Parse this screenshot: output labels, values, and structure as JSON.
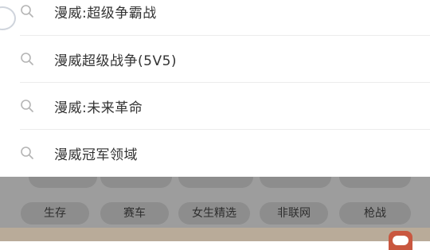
{
  "suggestions": [
    {
      "label": "漫威:超级争霸战",
      "icon": "search-icon"
    },
    {
      "label": "漫威超级战争(5V5)",
      "icon": "search-icon"
    },
    {
      "label": "漫威:未来革命",
      "icon": "search-icon"
    },
    {
      "label": "漫威冠军领域",
      "icon": "search-icon"
    }
  ],
  "categories": {
    "row2": [
      "生存",
      "赛车",
      "女生精选",
      "非联网",
      "枪战"
    ]
  },
  "colors": {
    "overlay": "#9d9d9d",
    "chip": "#8d8d8d",
    "bottom_strip": "#b9ab99",
    "badge": "#c9573f"
  }
}
